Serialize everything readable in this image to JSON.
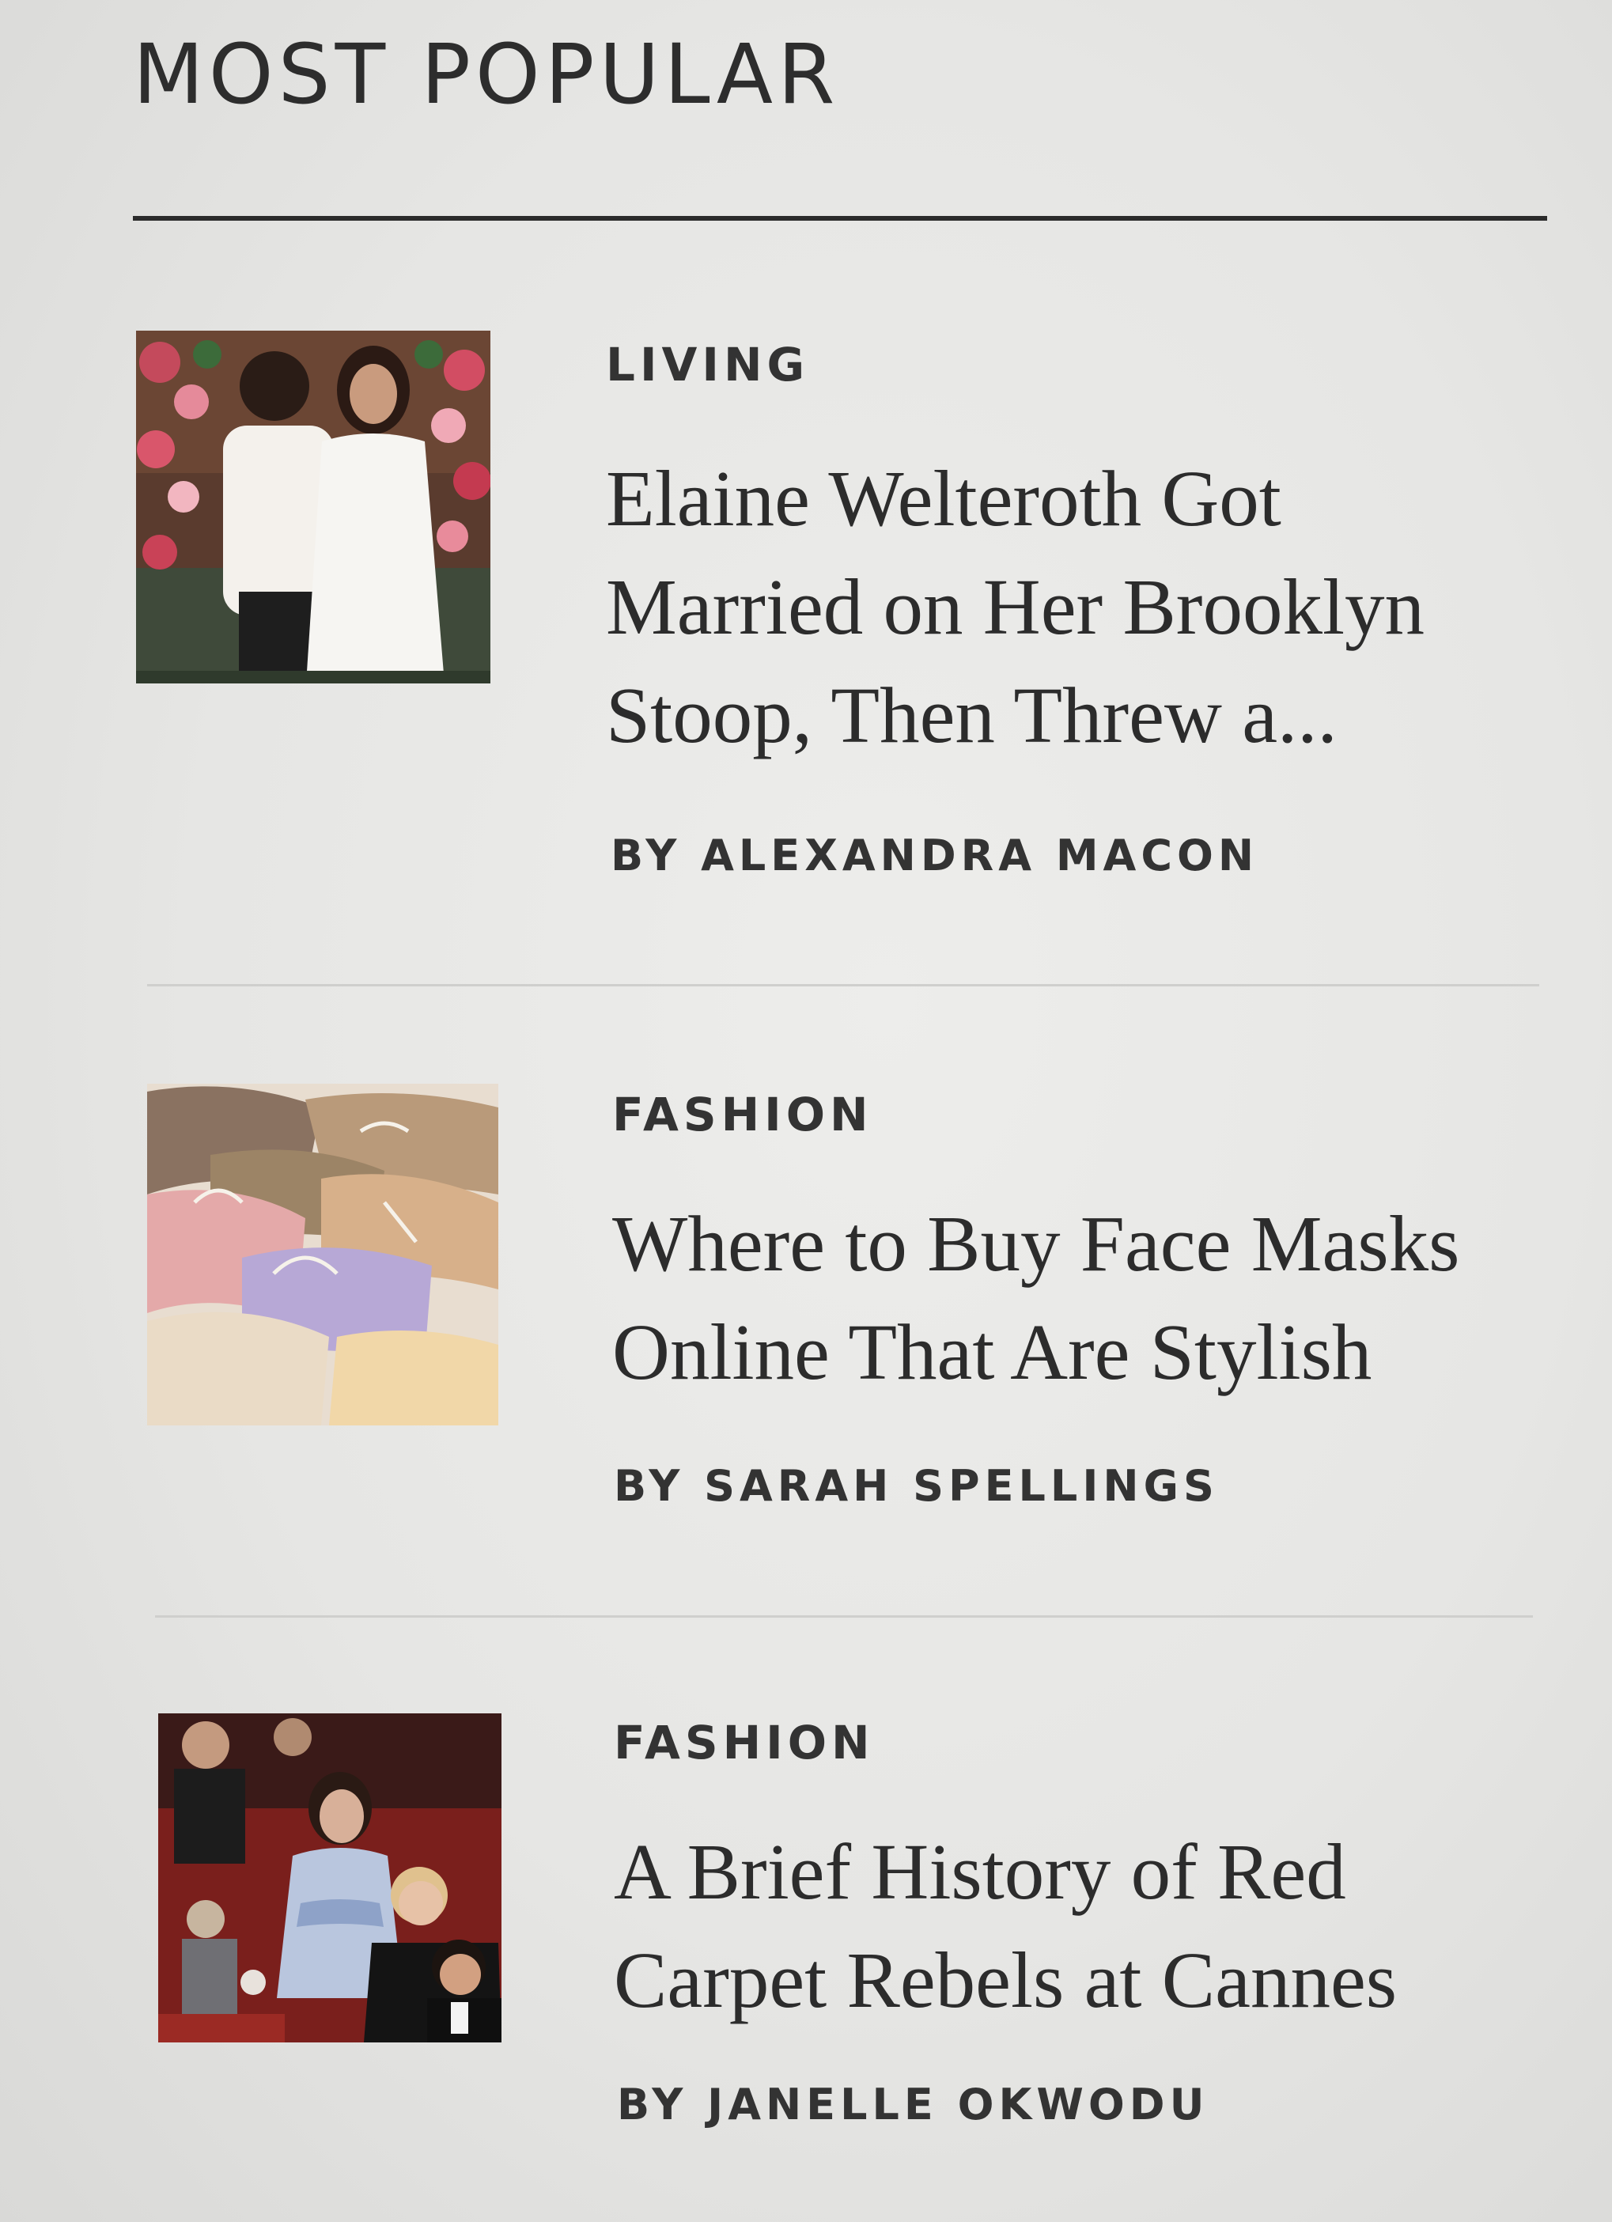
{
  "section": {
    "title": "MOST POPULAR"
  },
  "articles": [
    {
      "category": "LIVING",
      "headline": "Elaine Welteroth Got Married on Her Brooklyn Stoop, Then Threw a...",
      "byline": "BY ALEXANDRA MACON"
    },
    {
      "category": "FASHION",
      "headline": "Where to Buy Face Masks Online That Are Stylish",
      "byline": "BY SARAH SPELLINGS"
    },
    {
      "category": "FASHION",
      "headline": "A Brief History of Red Carpet Rebels at Cannes",
      "byline": "BY JANELLE OKWODU"
    }
  ]
}
